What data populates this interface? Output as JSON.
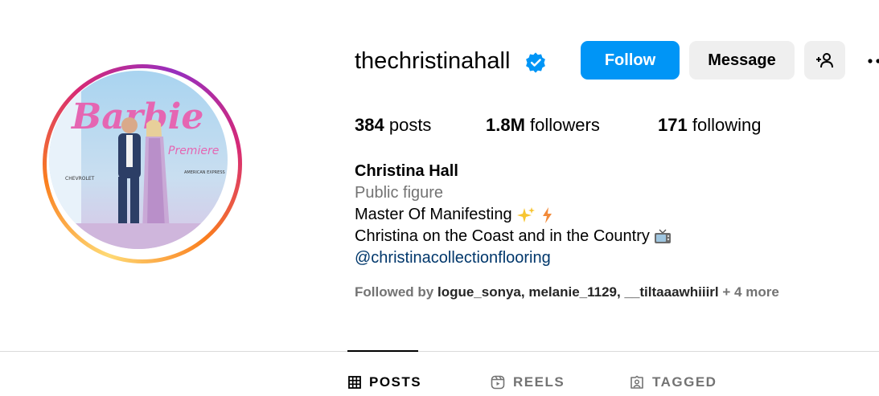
{
  "profile": {
    "username": "thechristinahall",
    "verified_icon": "verified-badge-icon",
    "avatar_text": {
      "brand": "Barbie",
      "subtitle": "Premiere",
      "sponsor_left": "CHEVROLET",
      "sponsor_right": "AMERICAN EXPRESS"
    }
  },
  "actions": {
    "follow": "Follow",
    "message": "Message",
    "add_user_icon": "add-user-icon",
    "more_icon": "more-options-icon"
  },
  "stats": {
    "posts_count": "384",
    "posts_label": "posts",
    "followers_count": "1.8M",
    "followers_label": "followers",
    "following_count": "171",
    "following_label": "following"
  },
  "bio": {
    "name": "Christina Hall",
    "category": "Public figure",
    "line1": "Master Of Manifesting",
    "line2": "Christina on the Coast and in the Country",
    "link": "@christinacollectionflooring"
  },
  "followed_by": {
    "prefix": "Followed by",
    "user1": "logue_sonya",
    "sep1": ",",
    "user2": "melanie_1129",
    "sep2": ",",
    "user3": "__tiltaaawhiiirl",
    "more": "+ 4 more"
  },
  "tabs": [
    {
      "label": "POSTS",
      "icon": "grid-icon",
      "active": true
    },
    {
      "label": "REELS",
      "icon": "reels-icon",
      "active": false
    },
    {
      "label": "TAGGED",
      "icon": "tagged-icon",
      "active": false
    }
  ],
  "colors": {
    "primary_blue": "#0095f6",
    "secondary_gray": "#efefef",
    "muted_text": "#737373",
    "link_text": "#00376b"
  }
}
